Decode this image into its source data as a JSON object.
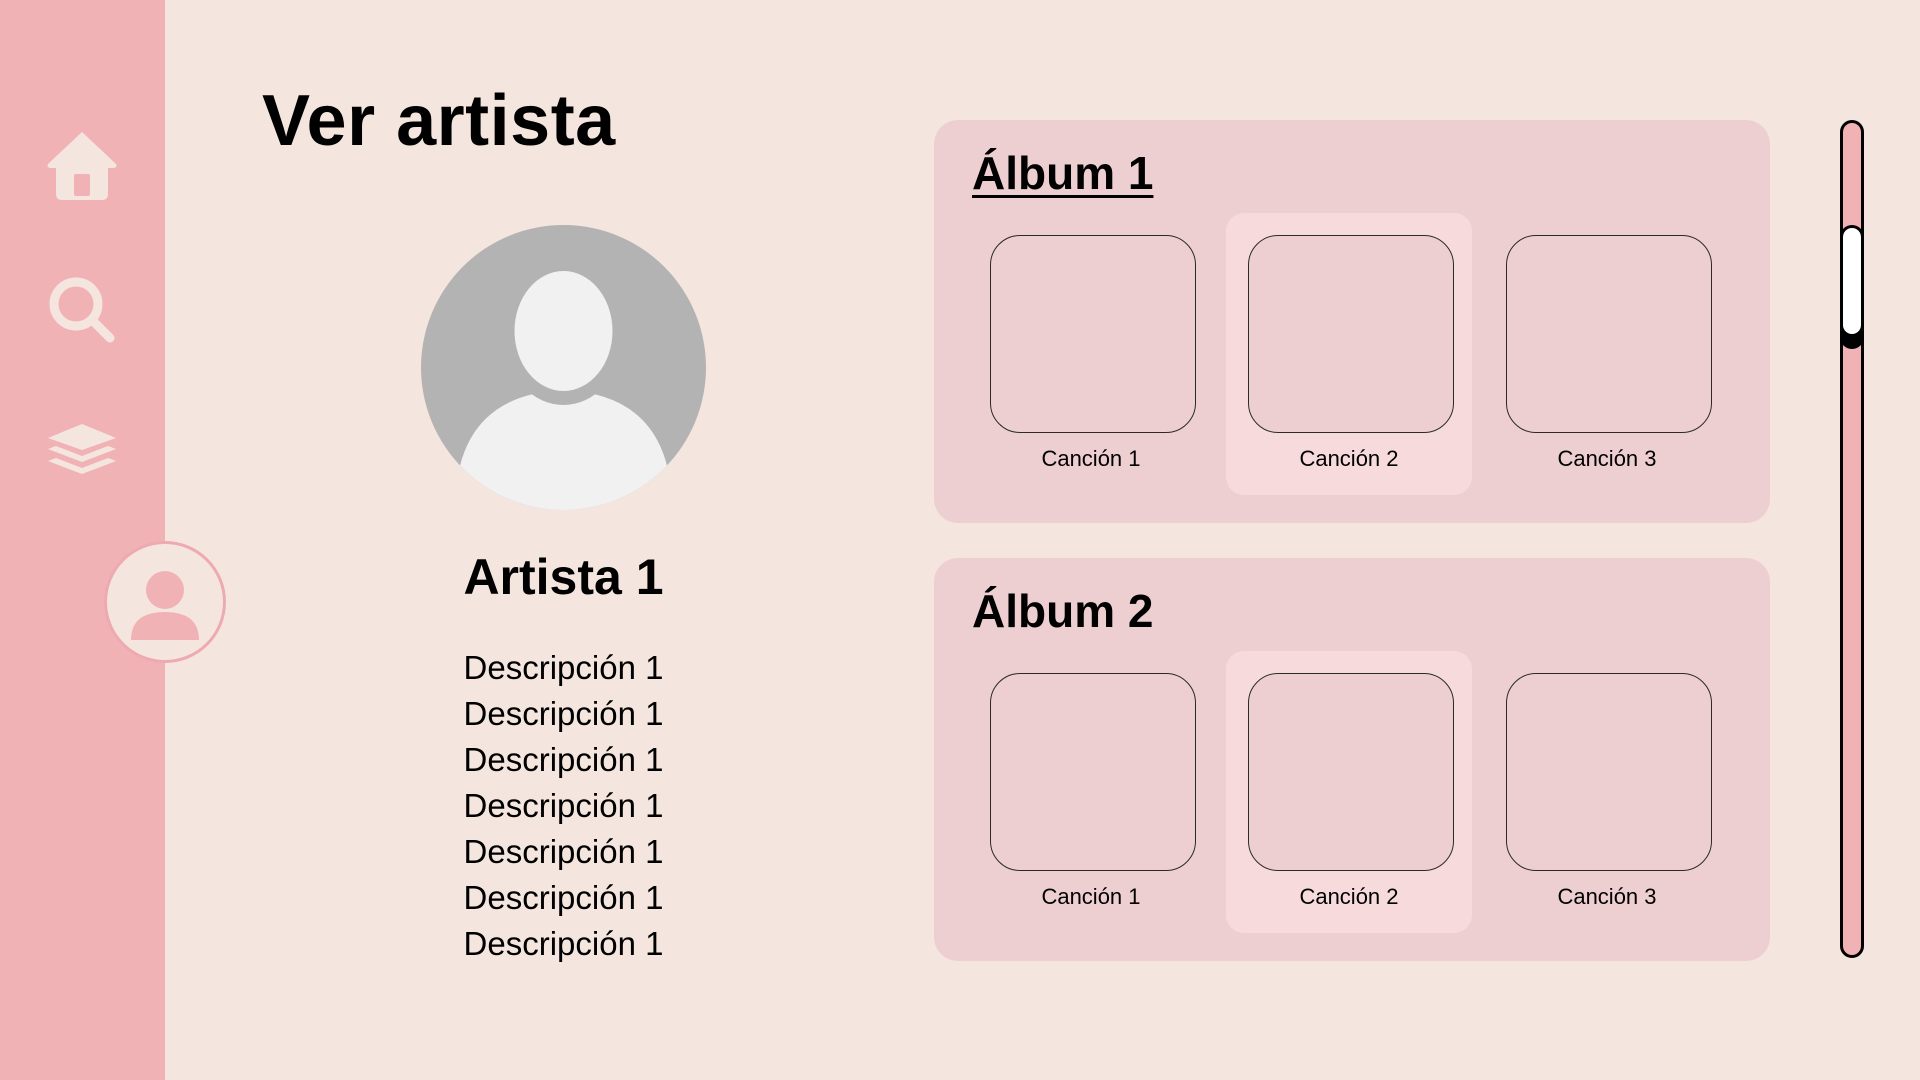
{
  "page": {
    "title": "Ver artista"
  },
  "sidebar": {
    "items": [
      {
        "name": "home",
        "icon": "home-icon"
      },
      {
        "name": "search",
        "icon": "search-icon"
      },
      {
        "name": "library",
        "icon": "layers-icon"
      },
      {
        "name": "profile",
        "icon": "user-icon",
        "active": true
      }
    ]
  },
  "artist": {
    "name": "Artista 1",
    "descriptions": [
      "Descripción 1",
      "Descripción 1",
      "Descripción 1",
      "Descripción 1",
      "Descripción 1",
      "Descripción 1",
      "Descripción 1"
    ]
  },
  "albums": [
    {
      "title": "Álbum 1",
      "songs": [
        "Canción 1",
        "Canción 2",
        "Canción 3"
      ]
    },
    {
      "title": "Álbum 2",
      "songs": [
        "Canción 1",
        "Canción 2",
        "Canción 3"
      ]
    }
  ],
  "colors": {
    "background": "#f4e6df",
    "sidebar": "#f1b2b6",
    "album_card": "#eecfd1",
    "song_highlight": "#f7dbdc"
  }
}
